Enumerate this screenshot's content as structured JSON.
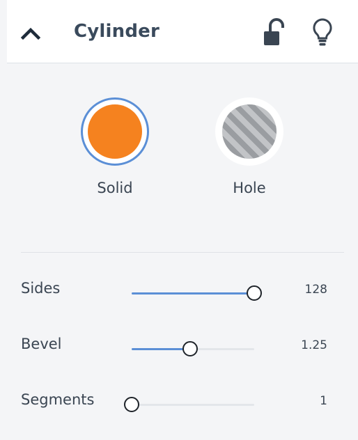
{
  "header": {
    "title": "Cylinder",
    "collapse_icon": "chevron-up-icon",
    "lock_icon": "unlock-icon",
    "bulb_icon": "lightbulb-icon"
  },
  "shape_type": {
    "options": [
      {
        "label": "Solid",
        "selected": true,
        "color": "#f5821f"
      },
      {
        "label": "Hole",
        "selected": false,
        "pattern": "gray-diagonal-stripes"
      }
    ],
    "selected_ring_color": "#5b8fd6"
  },
  "sliders": [
    {
      "label": "Sides",
      "value": "128",
      "fraction": 1.0
    },
    {
      "label": "Bevel",
      "value": "1.25",
      "fraction": 0.48
    },
    {
      "label": "Segments",
      "value": "1",
      "fraction": 0.0
    }
  ],
  "colors": {
    "accent": "#5b8fd6",
    "solid": "#f5821f",
    "background": "#f4f5f7",
    "text": "#3a4552"
  }
}
